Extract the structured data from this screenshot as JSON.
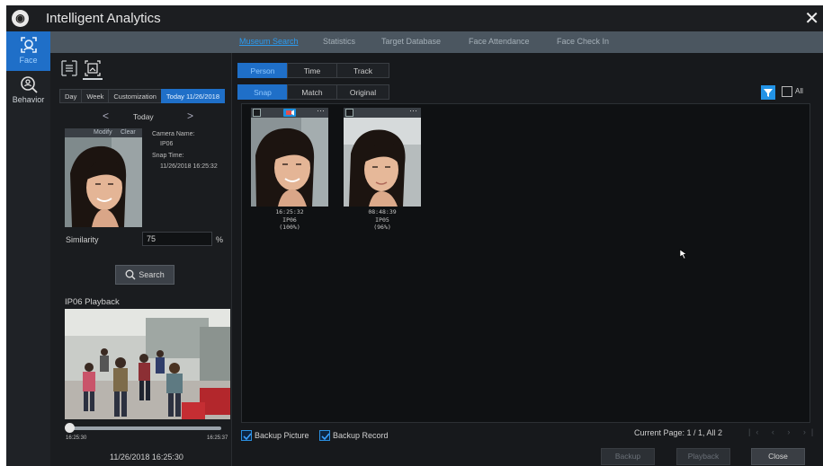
{
  "app": {
    "title": "Intelligent Analytics",
    "logo_icon": "camera-logo-icon",
    "close_icon": "close-icon"
  },
  "tabs": [
    {
      "label": "Museum Search",
      "active": true
    },
    {
      "label": "Statistics",
      "active": false
    },
    {
      "label": "Target Database",
      "active": false
    },
    {
      "label": "Face Attendance",
      "active": false
    },
    {
      "label": "Face Check In",
      "active": false
    }
  ],
  "sidebar": {
    "items": [
      {
        "label": "Face",
        "icon": "face-icon",
        "active": true
      },
      {
        "label": "Behavior",
        "icon": "behavior-icon",
        "active": false
      }
    ]
  },
  "left": {
    "date_buttons": [
      {
        "label": "Day",
        "active": false
      },
      {
        "label": "Week",
        "active": false
      },
      {
        "label": "Customization",
        "active": false
      },
      {
        "label": "Today 11/26/2018",
        "active": true
      }
    ],
    "day_nav": {
      "prev": "<",
      "label": "Today",
      "next": ">"
    },
    "snapshot": {
      "modify_label": "Modify",
      "clear_label": "Clear",
      "camera_name_label": "Camera Name:",
      "camera_name": "IP06",
      "snap_time_label": "Snap Time:",
      "snap_time": "11/26/2018 16:25:32"
    },
    "similarity": {
      "label": "Similarity",
      "value": "75",
      "unit": "%"
    },
    "search_button": "Search",
    "playback": {
      "title": "IP06 Playback",
      "start_time": "16:25:30",
      "end_time": "16:25:37",
      "progress": 0,
      "timestamp": "11/26/2018 16:25:30"
    }
  },
  "main": {
    "mode_tabs": [
      {
        "label": "Person",
        "active": true
      },
      {
        "label": "Time",
        "active": false
      },
      {
        "label": "Track",
        "active": false
      }
    ],
    "view_tabs": [
      {
        "label": "Snap",
        "active": true
      },
      {
        "label": "Match",
        "active": false
      },
      {
        "label": "Original",
        "active": false
      }
    ],
    "filter_icon": "filter-icon",
    "all_label": "All",
    "results": [
      {
        "time": "16:25:32",
        "camera": "IP06",
        "similarity": "(100%)",
        "badge_color": "#1a8fe0"
      },
      {
        "time": "08:48:39",
        "camera": "IP05",
        "similarity": "(96%)",
        "badge_color": "#3a3f45"
      }
    ],
    "backup_picture": {
      "label": "Backup Picture",
      "checked": true
    },
    "backup_record": {
      "label": "Backup Record",
      "checked": true
    },
    "page_info": "Current Page: 1 / 1, All 2",
    "buttons": {
      "backup": "Backup",
      "playback": "Playback",
      "close": "Close"
    }
  },
  "colors": {
    "accent": "#1f6fc8",
    "bg": "#17191c",
    "tabbar": "#4b5660"
  }
}
